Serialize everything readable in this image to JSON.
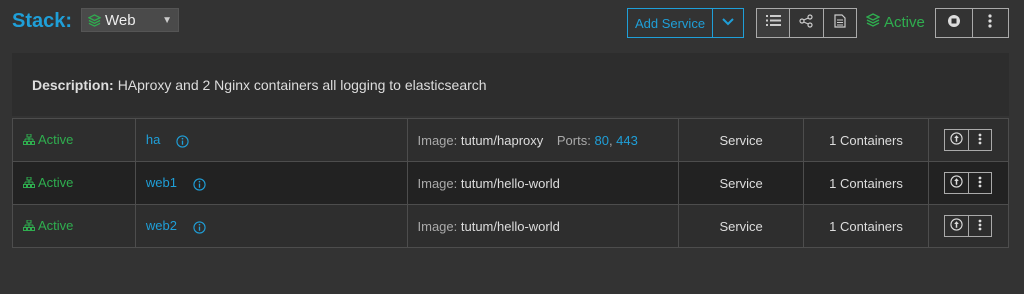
{
  "header": {
    "stack_label": "Stack:",
    "stack_select": {
      "value": "Web"
    },
    "add_service_label": "Add Service",
    "status": "Active"
  },
  "colors": {
    "accent": "#1f9fd8",
    "active": "#2fae4f"
  },
  "icons": {
    "stack_select": "cube-stack-icon",
    "add_service_dropdown": "chevron-down-icon",
    "view_buttons": [
      "list-icon",
      "share-icon",
      "document-icon"
    ],
    "status": "layers-icon",
    "header_actions": [
      "stop-icon",
      "more-vertical-icon"
    ],
    "row_state": "sitemap-icon",
    "row_info": "info-icon",
    "row_actions": [
      "redeploy-icon",
      "more-vertical-icon"
    ]
  },
  "description": {
    "label": "Description:",
    "text": "HAproxy and 2 Nginx containers all logging to elasticsearch"
  },
  "services": [
    {
      "state": "Active",
      "name": "ha",
      "image_label": "Image:",
      "image": "tutum/haproxy",
      "ports_label": "Ports:",
      "ports": [
        "80",
        "443"
      ],
      "kind": "Service",
      "containers": "1 Containers"
    },
    {
      "state": "Active",
      "name": "web1",
      "image_label": "Image:",
      "image": "tutum/hello-world",
      "kind": "Service",
      "containers": "1 Containers"
    },
    {
      "state": "Active",
      "name": "web2",
      "image_label": "Image:",
      "image": "tutum/hello-world",
      "kind": "Service",
      "containers": "1 Containers"
    }
  ]
}
